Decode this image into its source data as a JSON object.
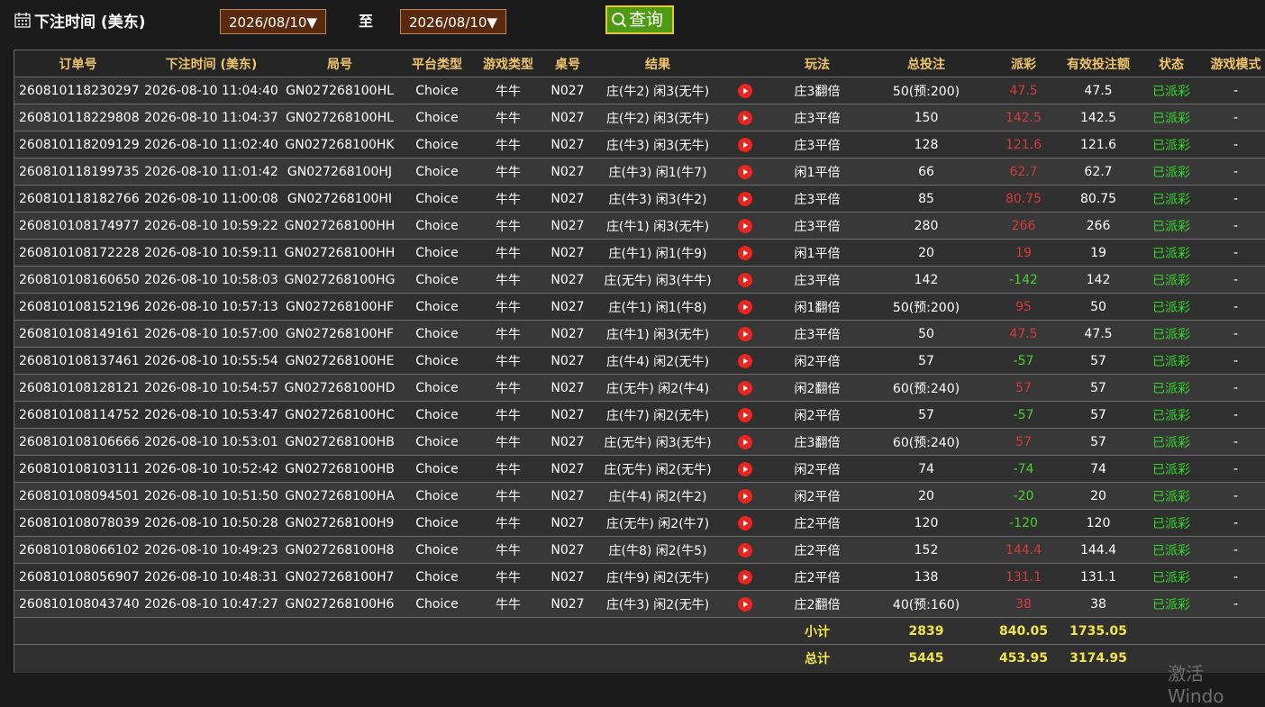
{
  "filter": {
    "label": "下注时间 (美东)",
    "start_date": "2026/08/10",
    "to_label": "至",
    "end_date": "2026/08/10",
    "query_label": "查询"
  },
  "columns": [
    "订单号",
    "下注时间 (美东)",
    "局号",
    "平台类型",
    "游戏类型",
    "桌号",
    "结果",
    "",
    "玩法",
    "总投注",
    "派彩",
    "有效投注额",
    "状态",
    "游戏模式"
  ],
  "rows": [
    {
      "order": "260810118230297",
      "time": "2026-08-10 11:04:40",
      "round": "GN027268100HL",
      "platform": "Choice",
      "game": "牛牛",
      "table": "N027",
      "result": "庄(牛2) 闲3(无牛)",
      "bet_type": "庄3翻倍",
      "total": "50(预:200)",
      "payout": "47.5",
      "payout_sign": "win",
      "valid": "47.5",
      "status": "已派彩",
      "mode": "-"
    },
    {
      "order": "260810118229808",
      "time": "2026-08-10 11:04:37",
      "round": "GN027268100HL",
      "platform": "Choice",
      "game": "牛牛",
      "table": "N027",
      "result": "庄(牛2) 闲3(无牛)",
      "bet_type": "庄3平倍",
      "total": "150",
      "payout": "142.5",
      "payout_sign": "win",
      "valid": "142.5",
      "status": "已派彩",
      "mode": "-"
    },
    {
      "order": "260810118209129",
      "time": "2026-08-10 11:02:40",
      "round": "GN027268100HK",
      "platform": "Choice",
      "game": "牛牛",
      "table": "N027",
      "result": "庄(牛3) 闲3(无牛)",
      "bet_type": "庄3平倍",
      "total": "128",
      "payout": "121.6",
      "payout_sign": "win",
      "valid": "121.6",
      "status": "已派彩",
      "mode": "-"
    },
    {
      "order": "260810118199735",
      "time": "2026-08-10 11:01:42",
      "round": "GN027268100HJ",
      "platform": "Choice",
      "game": "牛牛",
      "table": "N027",
      "result": "庄(牛3) 闲1(牛7)",
      "bet_type": "闲1平倍",
      "total": "66",
      "payout": "62.7",
      "payout_sign": "win",
      "valid": "62.7",
      "status": "已派彩",
      "mode": "-"
    },
    {
      "order": "260810118182766",
      "time": "2026-08-10 11:00:08",
      "round": "GN027268100HI",
      "platform": "Choice",
      "game": "牛牛",
      "table": "N027",
      "result": "庄(牛3) 闲3(牛2)",
      "bet_type": "庄3平倍",
      "total": "85",
      "payout": "80.75",
      "payout_sign": "win",
      "valid": "80.75",
      "status": "已派彩",
      "mode": "-"
    },
    {
      "order": "260810108174977",
      "time": "2026-08-10 10:59:22",
      "round": "GN027268100HH",
      "platform": "Choice",
      "game": "牛牛",
      "table": "N027",
      "result": "庄(牛1) 闲3(无牛)",
      "bet_type": "庄3平倍",
      "total": "280",
      "payout": "266",
      "payout_sign": "win",
      "valid": "266",
      "status": "已派彩",
      "mode": "-"
    },
    {
      "order": "260810108172228",
      "time": "2026-08-10 10:59:11",
      "round": "GN027268100HH",
      "platform": "Choice",
      "game": "牛牛",
      "table": "N027",
      "result": "庄(牛1) 闲1(牛9)",
      "bet_type": "闲1平倍",
      "total": "20",
      "payout": "19",
      "payout_sign": "win",
      "valid": "19",
      "status": "已派彩",
      "mode": "-"
    },
    {
      "order": "260810108160650",
      "time": "2026-08-10 10:58:03",
      "round": "GN027268100HG",
      "platform": "Choice",
      "game": "牛牛",
      "table": "N027",
      "result": "庄(无牛) 闲3(牛牛)",
      "bet_type": "庄3平倍",
      "total": "142",
      "payout": "-142",
      "payout_sign": "loss",
      "valid": "142",
      "status": "已派彩",
      "mode": "-"
    },
    {
      "order": "260810108152196",
      "time": "2026-08-10 10:57:13",
      "round": "GN027268100HF",
      "platform": "Choice",
      "game": "牛牛",
      "table": "N027",
      "result": "庄(牛1) 闲1(牛8)",
      "bet_type": "闲1翻倍",
      "total": "50(预:200)",
      "payout": "95",
      "payout_sign": "win",
      "valid": "50",
      "status": "已派彩",
      "mode": "-"
    },
    {
      "order": "260810108149161",
      "time": "2026-08-10 10:57:00",
      "round": "GN027268100HF",
      "platform": "Choice",
      "game": "牛牛",
      "table": "N027",
      "result": "庄(牛1) 闲3(无牛)",
      "bet_type": "庄3平倍",
      "total": "50",
      "payout": "47.5",
      "payout_sign": "win",
      "valid": "47.5",
      "status": "已派彩",
      "mode": "-"
    },
    {
      "order": "260810108137461",
      "time": "2026-08-10 10:55:54",
      "round": "GN027268100HE",
      "platform": "Choice",
      "game": "牛牛",
      "table": "N027",
      "result": "庄(牛4) 闲2(无牛)",
      "bet_type": "闲2平倍",
      "total": "57",
      "payout": "-57",
      "payout_sign": "loss",
      "valid": "57",
      "status": "已派彩",
      "mode": "-"
    },
    {
      "order": "260810108128121",
      "time": "2026-08-10 10:54:57",
      "round": "GN027268100HD",
      "platform": "Choice",
      "game": "牛牛",
      "table": "N027",
      "result": "庄(无牛) 闲2(牛4)",
      "bet_type": "闲2翻倍",
      "total": "60(预:240)",
      "payout": "57",
      "payout_sign": "win",
      "valid": "57",
      "status": "已派彩",
      "mode": "-"
    },
    {
      "order": "260810108114752",
      "time": "2026-08-10 10:53:47",
      "round": "GN027268100HC",
      "platform": "Choice",
      "game": "牛牛",
      "table": "N027",
      "result": "庄(牛7) 闲2(无牛)",
      "bet_type": "闲2平倍",
      "total": "57",
      "payout": "-57",
      "payout_sign": "loss",
      "valid": "57",
      "status": "已派彩",
      "mode": "-"
    },
    {
      "order": "260810108106666",
      "time": "2026-08-10 10:53:01",
      "round": "GN027268100HB",
      "platform": "Choice",
      "game": "牛牛",
      "table": "N027",
      "result": "庄(无牛) 闲3(无牛)",
      "bet_type": "庄3翻倍",
      "total": "60(预:240)",
      "payout": "57",
      "payout_sign": "win",
      "valid": "57",
      "status": "已派彩",
      "mode": "-"
    },
    {
      "order": "260810108103111",
      "time": "2026-08-10 10:52:42",
      "round": "GN027268100HB",
      "platform": "Choice",
      "game": "牛牛",
      "table": "N027",
      "result": "庄(无牛) 闲2(无牛)",
      "bet_type": "闲2平倍",
      "total": "74",
      "payout": "-74",
      "payout_sign": "loss",
      "valid": "74",
      "status": "已派彩",
      "mode": "-"
    },
    {
      "order": "260810108094501",
      "time": "2026-08-10 10:51:50",
      "round": "GN027268100HA",
      "platform": "Choice",
      "game": "牛牛",
      "table": "N027",
      "result": "庄(牛4) 闲2(牛2)",
      "bet_type": "闲2平倍",
      "total": "20",
      "payout": "-20",
      "payout_sign": "loss",
      "valid": "20",
      "status": "已派彩",
      "mode": "-"
    },
    {
      "order": "260810108078039",
      "time": "2026-08-10 10:50:28",
      "round": "GN027268100H9",
      "platform": "Choice",
      "game": "牛牛",
      "table": "N027",
      "result": "庄(无牛) 闲2(牛7)",
      "bet_type": "庄2平倍",
      "total": "120",
      "payout": "-120",
      "payout_sign": "loss",
      "valid": "120",
      "status": "已派彩",
      "mode": "-"
    },
    {
      "order": "260810108066102",
      "time": "2026-08-10 10:49:23",
      "round": "GN027268100H8",
      "platform": "Choice",
      "game": "牛牛",
      "table": "N027",
      "result": "庄(牛8) 闲2(牛5)",
      "bet_type": "庄2平倍",
      "total": "152",
      "payout": "144.4",
      "payout_sign": "win",
      "valid": "144.4",
      "status": "已派彩",
      "mode": "-"
    },
    {
      "order": "260810108056907",
      "time": "2026-08-10 10:48:31",
      "round": "GN027268100H7",
      "platform": "Choice",
      "game": "牛牛",
      "table": "N027",
      "result": "庄(牛9) 闲2(无牛)",
      "bet_type": "庄2平倍",
      "total": "138",
      "payout": "131.1",
      "payout_sign": "win",
      "valid": "131.1",
      "status": "已派彩",
      "mode": "-"
    },
    {
      "order": "260810108043740",
      "time": "2026-08-10 10:47:27",
      "round": "GN027268100H6",
      "platform": "Choice",
      "game": "牛牛",
      "table": "N027",
      "result": "庄(牛3) 闲2(无牛)",
      "bet_type": "庄2翻倍",
      "total": "40(预:160)",
      "payout": "38",
      "payout_sign": "win",
      "valid": "38",
      "status": "已派彩",
      "mode": "-"
    }
  ],
  "subtotal": {
    "label": "小计",
    "total": "2839",
    "payout": "840.05",
    "valid": "1735.05"
  },
  "grand_total": {
    "label": "总计",
    "total": "5445",
    "payout": "453.95",
    "valid": "3174.95"
  },
  "watermark": "激活 Windo",
  "colors": {
    "win": "#d63a3a",
    "loss": "#4ccf2e",
    "status": "#33d829",
    "header_text": "#f0c46d",
    "totals": "#f2e34b",
    "query_button": "#4e9a12",
    "date_box": "#5a2a0f"
  }
}
